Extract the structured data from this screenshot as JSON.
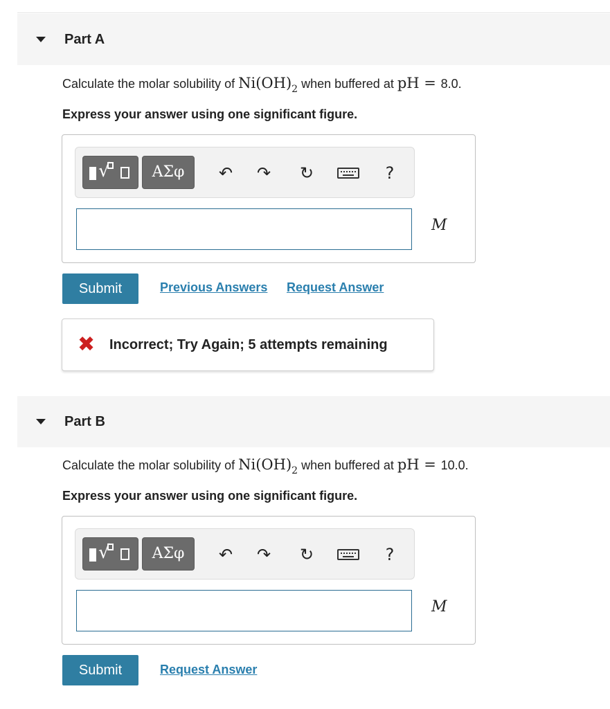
{
  "partA": {
    "title": "Part A",
    "question_prefix": "Calculate the molar solubility of ",
    "formula_main": "Ni(OH)",
    "formula_sub": "2",
    "question_mid": " when buffered at ",
    "ph_label": "pH",
    "eq": " = ",
    "ph_value": "8.0.",
    "instruction": "Express your answer using one significant figure.",
    "greek_label": "ΑΣφ",
    "help_label": "?",
    "unit": "M",
    "input_value": "",
    "submit_label": "Submit",
    "previous_answers_label": "Previous Answers",
    "request_answer_label": "Request Answer",
    "feedback_text": "Incorrect; Try Again; 5 attempts remaining"
  },
  "partB": {
    "title": "Part B",
    "question_prefix": "Calculate the molar solubility of ",
    "formula_main": "Ni(OH)",
    "formula_sub": "2",
    "question_mid": " when buffered at ",
    "ph_label": "pH",
    "eq": " = ",
    "ph_value": "10.0.",
    "instruction": "Express your answer using one significant figure.",
    "greek_label": "ΑΣφ",
    "help_label": "?",
    "unit": "M",
    "input_value": "",
    "submit_label": "Submit",
    "request_answer_label": "Request Answer"
  },
  "icons": {
    "templates": "templates-icon",
    "greek": "greek-symbols-icon",
    "undo": "undo-icon",
    "redo": "redo-icon",
    "reset": "reset-icon",
    "keyboard": "keyboard-icon",
    "help": "help-icon",
    "incorrect": "x-mark-icon"
  },
  "colors": {
    "submit_bg": "#2f7ea2",
    "link": "#2a7fae",
    "incorrect": "#cc1f1f",
    "toolbar_btn": "#6b6b6b"
  }
}
